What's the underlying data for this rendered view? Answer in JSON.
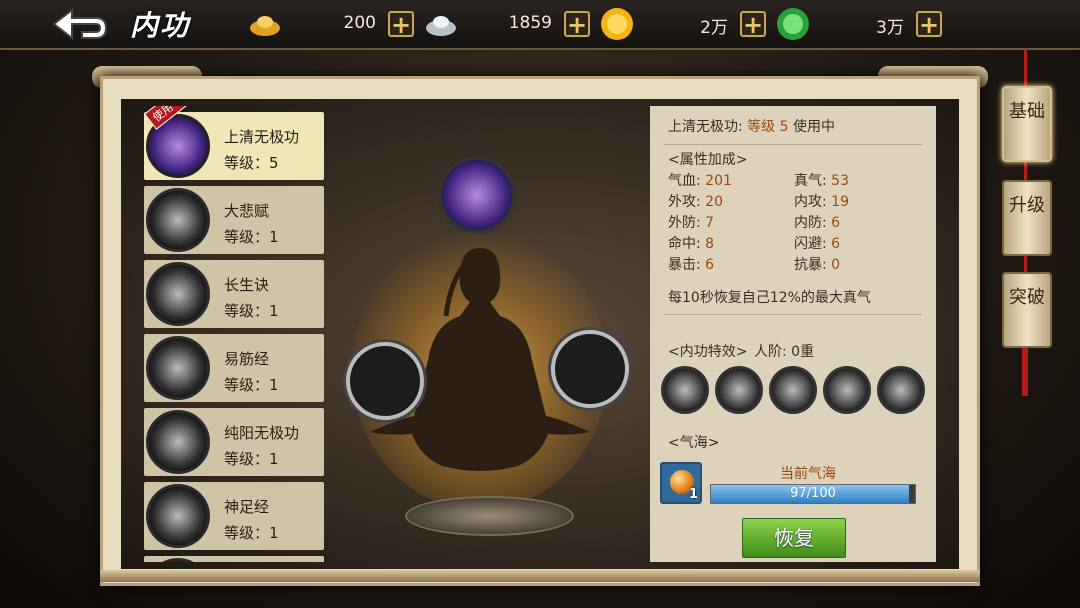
{
  "header": {
    "title": "内功",
    "currencies": [
      {
        "icon": "gold-ingot-icon",
        "value": "200"
      },
      {
        "icon": "silver-ingot-icon",
        "value": "1859"
      },
      {
        "icon": "gold-coin-icon",
        "value": "2万"
      },
      {
        "icon": "jade-coin-icon",
        "value": "3万"
      }
    ],
    "plus_label": "+"
  },
  "skills": [
    {
      "name": "上清无极功",
      "level": "等级：5",
      "badge": "使用中",
      "active": true
    },
    {
      "name": "大悲赋",
      "level": "等级：1"
    },
    {
      "name": "长生诀",
      "level": "等级：1"
    },
    {
      "name": "易筋经",
      "level": "等级：1"
    },
    {
      "name": "纯阳无极功",
      "level": "等级：1"
    },
    {
      "name": "神足经",
      "level": "等级：1"
    }
  ],
  "info": {
    "heading_name": "上清无极功:",
    "heading_level": "等级 5",
    "heading_status": "使用中",
    "attr_title": "<属性加成>",
    "attrs": [
      {
        "label": "气血:",
        "value": "201"
      },
      {
        "label": "真气:",
        "value": "53"
      },
      {
        "label": "外攻:",
        "value": "20"
      },
      {
        "label": "内攻:",
        "value": "19"
      },
      {
        "label": "外防:",
        "value": "7"
      },
      {
        "label": "内防:",
        "value": "6"
      },
      {
        "label": "命中:",
        "value": "8"
      },
      {
        "label": "闪避:",
        "value": "6"
      },
      {
        "label": "暴击:",
        "value": "6"
      },
      {
        "label": "抗暴:",
        "value": "0"
      }
    ],
    "recover_text": "每10秒恢复自己12%的最大真气",
    "effect_title": "<内功特效>",
    "rank_text": "人阶: 0重",
    "qihai_title": "<气海>",
    "qihai_label": "当前气海",
    "qihai_current": 97,
    "qihai_max": 100,
    "qihai_text": "97/100",
    "item_count": "1",
    "restore_label": "恢复"
  },
  "tabs": [
    {
      "label": "基础",
      "active": true
    },
    {
      "label": "升级"
    },
    {
      "label": "突破"
    }
  ],
  "colors": {
    "accent_orange": "#9a4a10",
    "bar_blue": "#2f7fc0",
    "restore_green": "#5aaa2a"
  }
}
